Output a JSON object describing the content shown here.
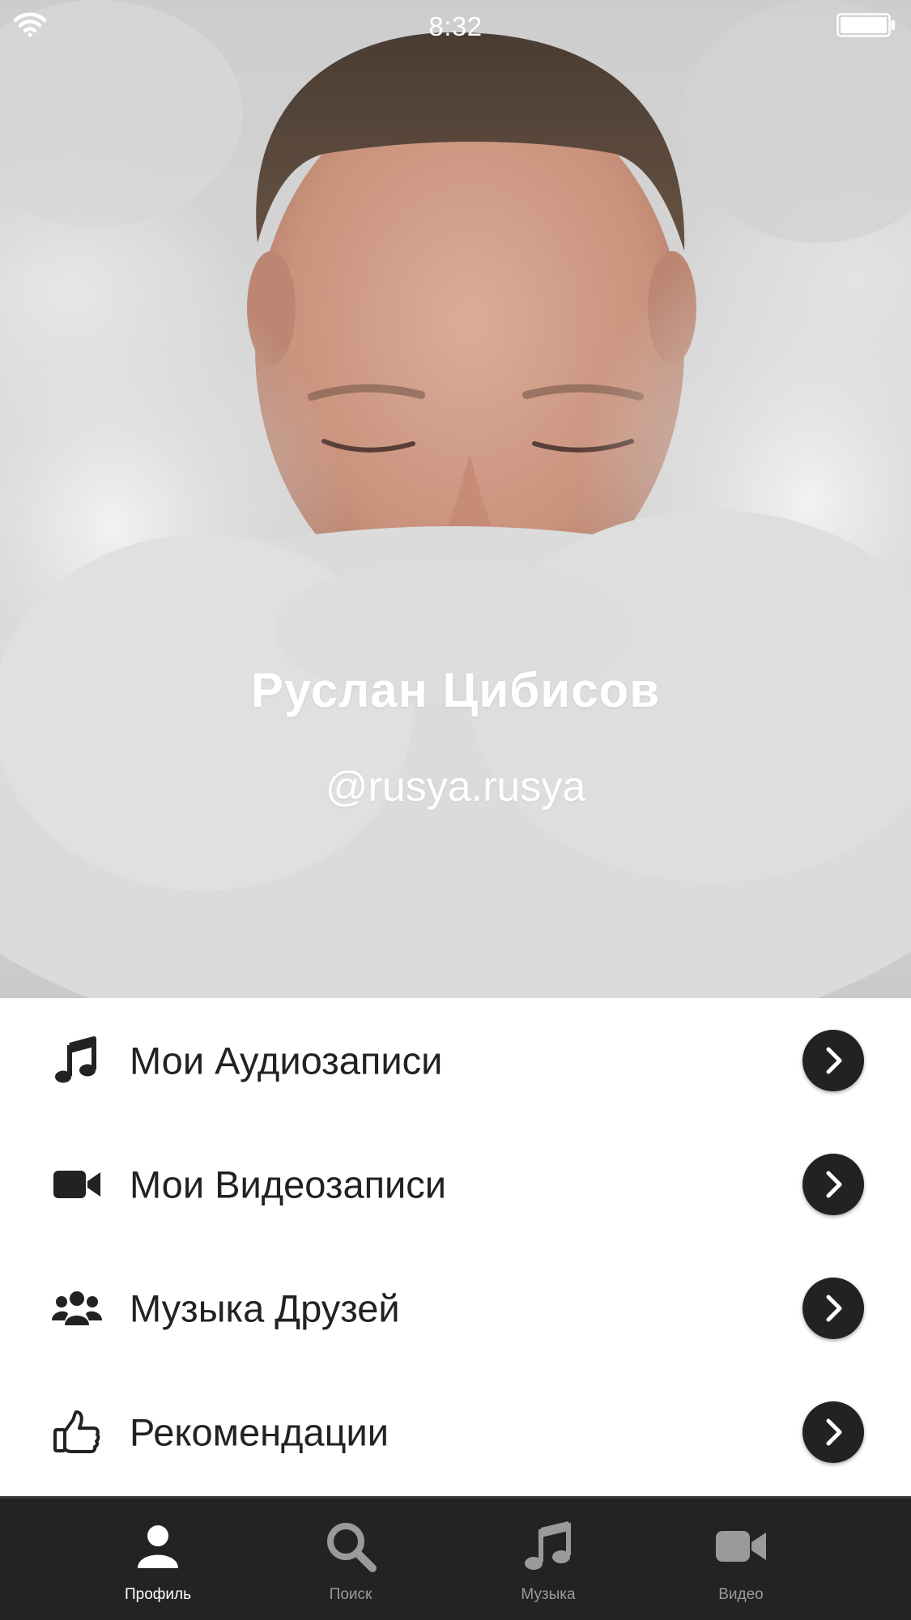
{
  "status_bar": {
    "time": "8:32"
  },
  "profile": {
    "name": "Руслан Цибисов",
    "handle": "@rusya.rusya"
  },
  "menu": {
    "items": [
      {
        "label": "Мои Аудиозаписи",
        "icon": "music-note-icon"
      },
      {
        "label": "Мои Видеозаписи",
        "icon": "video-camera-icon"
      },
      {
        "label": "Музыка Друзей",
        "icon": "users-icon"
      },
      {
        "label": "Рекомендации",
        "icon": "thumbs-up-icon"
      }
    ],
    "arrow_icon": "chevron-right-icon"
  },
  "tab_bar": {
    "tabs": [
      {
        "label": "Профиль",
        "icon": "user-icon",
        "active": true
      },
      {
        "label": "Поиск",
        "icon": "search-icon",
        "active": false
      },
      {
        "label": "Музыка",
        "icon": "music-note-icon",
        "active": false
      },
      {
        "label": "Видео",
        "icon": "video-camera-icon",
        "active": false
      }
    ]
  },
  "colors": {
    "tab_bar_background": "#232323",
    "active_tab": "#ffffff",
    "inactive_tab": "#9a9a9a",
    "menu_text": "#222222",
    "arrow_button": "#222222"
  }
}
